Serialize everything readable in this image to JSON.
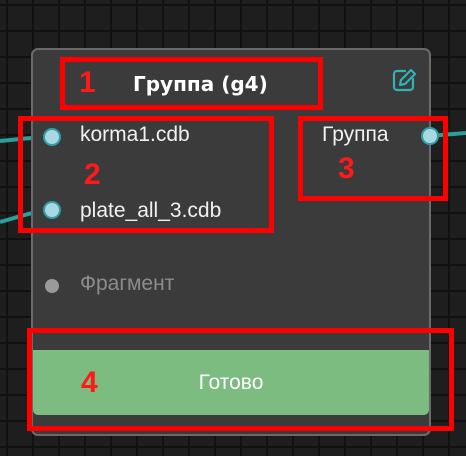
{
  "node": {
    "title": "Группа (g4)",
    "edit_icon": "pencil-square-icon",
    "inputs": [
      {
        "label": "korma1.cdb",
        "connected": true
      },
      {
        "label": "plate_all_3.cdb",
        "connected": true
      },
      {
        "label": "Фрагмент",
        "connected": false
      }
    ],
    "outputs": [
      {
        "label": "Группа",
        "connected": true
      }
    ],
    "status_button": "Готово"
  },
  "annotations": [
    {
      "number": "1"
    },
    {
      "number": "2"
    },
    {
      "number": "3"
    },
    {
      "number": "4"
    }
  ],
  "colors": {
    "port_connected": "#2f9fa8",
    "port_disconnected": "#9a9a9a",
    "status_ready": "#7cbc80",
    "annotation": "#ff0000"
  }
}
